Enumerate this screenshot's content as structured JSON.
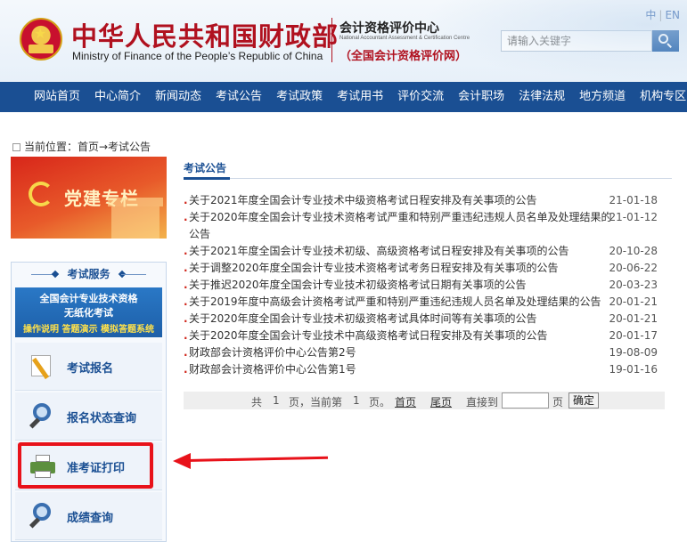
{
  "header": {
    "ministry_cn": "中华人民共和国财政部",
    "ministry_en": "Ministry of Finance of the People’s Republic of China",
    "center_cn": "会计资格评价中心",
    "center_en": "National Accountant Assessment & Certification Centre",
    "center_sub": "（全国会计资格评价网）",
    "lang_cn": "中",
    "lang_sep": "|",
    "lang_en": "EN",
    "search_placeholder": "请输入关键字"
  },
  "nav": [
    "网站首页",
    "中心简介",
    "新闻动态",
    "考试公告",
    "考试政策",
    "考试用书",
    "评价交流",
    "会计职场",
    "法律法规",
    "地方频道",
    "机构专区"
  ],
  "breadcrumb": "当前位置：首页→考试公告",
  "party_banner": "党建专栏",
  "service": {
    "title": "考试服务",
    "paperless_l1": "全国会计专业技术资格",
    "paperless_l2": "无纸化考试",
    "paperless_l3": "操作说明 答题演示 模拟答题系统",
    "items": [
      "考试报名",
      "报名状态查询",
      "准考证打印",
      "成绩查询"
    ]
  },
  "content": {
    "tab": "考试公告",
    "bullet": ".",
    "notices": [
      {
        "title": "关于2021年度全国会计专业技术中级资格考试日程安排及有关事项的公告",
        "date": "21-01-18"
      },
      {
        "title": "关于2020年度全国会计专业技术资格考试严重和特别严重违纪违规人员名单及处理结果的公告",
        "date": "21-01-12"
      },
      {
        "title": "关于2021年度全国会计专业技术初级、高级资格考试日程安排及有关事项的公告",
        "date": "20-10-28"
      },
      {
        "title": "关于调整2020年度全国会计专业技术资格考试考务日程安排及有关事项的公告",
        "date": "20-06-22"
      },
      {
        "title": "关于推迟2020年度全国会计专业技术初级资格考试日期有关事项的公告",
        "date": "20-03-23"
      },
      {
        "title": "关于2019年度中高级会计资格考试严重和特别严重违纪违规人员名单及处理结果的公告",
        "date": "20-01-21"
      },
      {
        "title": "关于2020年度全国会计专业技术初级资格考试具体时间等有关事项的公告",
        "date": "20-01-21"
      },
      {
        "title": "关于2020年度全国会计专业技术中高级资格考试日程安排及有关事项的公告",
        "date": "20-01-17"
      },
      {
        "title": "财政部会计资格评价中心公告第2号",
        "date": "19-08-09"
      },
      {
        "title": "财政部会计资格评价中心公告第1号",
        "date": "19-01-16"
      }
    ]
  },
  "pager": {
    "total_prefix": "共",
    "total_pages": "1",
    "total_suffix": "页，当前第",
    "current_page": "1",
    "current_suffix": "页。",
    "first": "首页",
    "last": "尾页",
    "goto": "直接到",
    "page_unit": "页",
    "confirm": "确定"
  }
}
